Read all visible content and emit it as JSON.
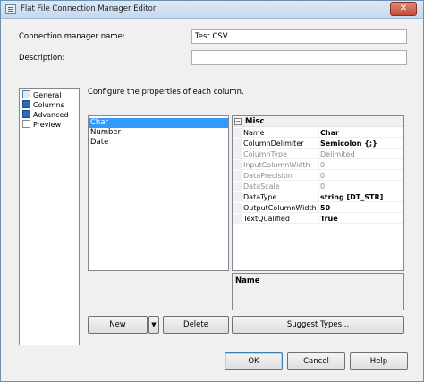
{
  "window": {
    "title": "Flat File Connection Manager Editor",
    "close_label": "✕"
  },
  "form": {
    "name_label": "Connection manager name:",
    "name_value": "Test CSV",
    "description_label": "Description:",
    "description_value": ""
  },
  "nav": {
    "items": [
      {
        "label": "General"
      },
      {
        "label": "Columns"
      },
      {
        "label": "Advanced"
      },
      {
        "label": "Preview"
      }
    ]
  },
  "main": {
    "description": "Configure the properties of each column.",
    "columns": [
      "Char",
      "Number",
      "Date"
    ],
    "selected_column": "Char"
  },
  "properties": {
    "category": "Misc",
    "expander": "−",
    "rows": [
      {
        "name": "Name",
        "value": "Char"
      },
      {
        "name": "ColumnDelimiter",
        "value": "Semicolon {;}"
      },
      {
        "name": "ColumnType",
        "value": "Delimited"
      },
      {
        "name": "InputColumnWidth",
        "value": "0"
      },
      {
        "name": "DataPrecision",
        "value": "0"
      },
      {
        "name": "DataScale",
        "value": "0"
      },
      {
        "name": "DataType",
        "value": "string [DT_STR]"
      },
      {
        "name": "OutputColumnWidth",
        "value": "50"
      },
      {
        "name": "TextQualified",
        "value": "True"
      }
    ],
    "help_title": "Name"
  },
  "actions": {
    "new_label": "New",
    "new_dropdown": "▼",
    "delete_label": "Delete",
    "suggest_label": "Suggest Types..."
  },
  "footer": {
    "ok_label": "OK",
    "cancel_label": "Cancel",
    "help_label": "Help"
  }
}
